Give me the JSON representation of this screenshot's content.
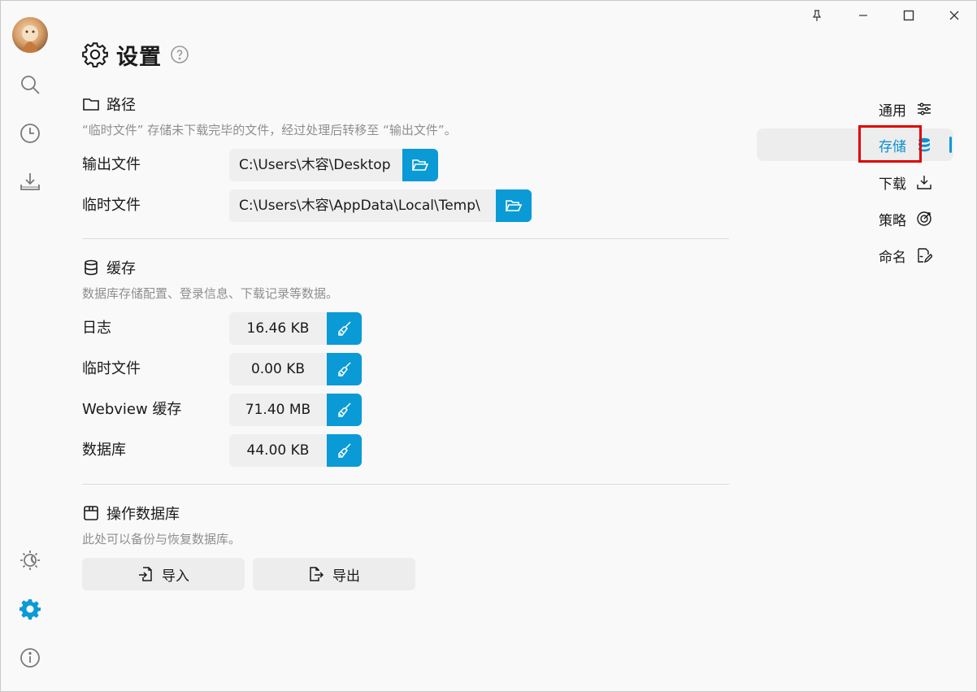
{
  "header": {
    "title": "设置"
  },
  "path_section": {
    "title": "路径",
    "description": "“临时文件” 存储未下载完毕的文件，经过处理后转移至 “输出文件”。",
    "rows": [
      {
        "label": "输出文件",
        "value": "C:\\Users\\木容\\Desktop"
      },
      {
        "label": "临时文件",
        "value": "C:\\Users\\木容\\AppData\\Local\\Temp\\"
      }
    ]
  },
  "cache_section": {
    "title": "缓存",
    "description": "数据库存储配置、登录信息、下载记录等数据。",
    "rows": [
      {
        "label": "日志",
        "value": "16.46 KB"
      },
      {
        "label": "临时文件",
        "value": "0.00 KB"
      },
      {
        "label": "Webview 缓存",
        "value": "71.40 MB"
      },
      {
        "label": "数据库",
        "value": "44.00 KB"
      }
    ]
  },
  "db_section": {
    "title": "操作数据库",
    "description": "此处可以备份与恢复数据库。",
    "import_label": "导入",
    "export_label": "导出"
  },
  "anchor_nav": {
    "items": [
      {
        "label": "通用",
        "icon": "sliders-icon"
      },
      {
        "label": "存储",
        "icon": "database-icon",
        "active": true
      },
      {
        "label": "下载",
        "icon": "download-icon"
      },
      {
        "label": "策略",
        "icon": "strategy-icon"
      },
      {
        "label": "命名",
        "icon": "rename-icon"
      }
    ]
  },
  "colors": {
    "accent": "#0a9ad6",
    "highlight": "#e00000"
  }
}
